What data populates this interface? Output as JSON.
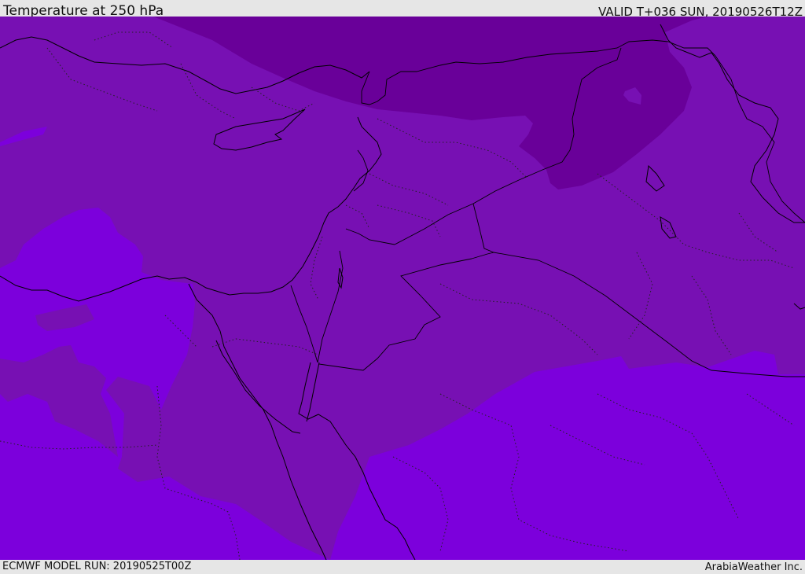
{
  "header": {
    "title": "Temperature at 250 hPa",
    "valid_time": "VALID T+036 SUN, 20190526T12Z"
  },
  "footer": {
    "model_run": "ECMWF MODEL RUN: 20190525T00Z",
    "credit": "ArabiaWeather Inc."
  },
  "map": {
    "field": "temperature",
    "pressure_level": "250 hPa",
    "fill_colors": {
      "warmest_band": "#7c00dc",
      "middle_band": "#7710b3",
      "coldest_band": "#690099"
    },
    "layers": [
      "shaded-contours",
      "coastlines",
      "country-borders",
      "province-borders"
    ]
  }
}
